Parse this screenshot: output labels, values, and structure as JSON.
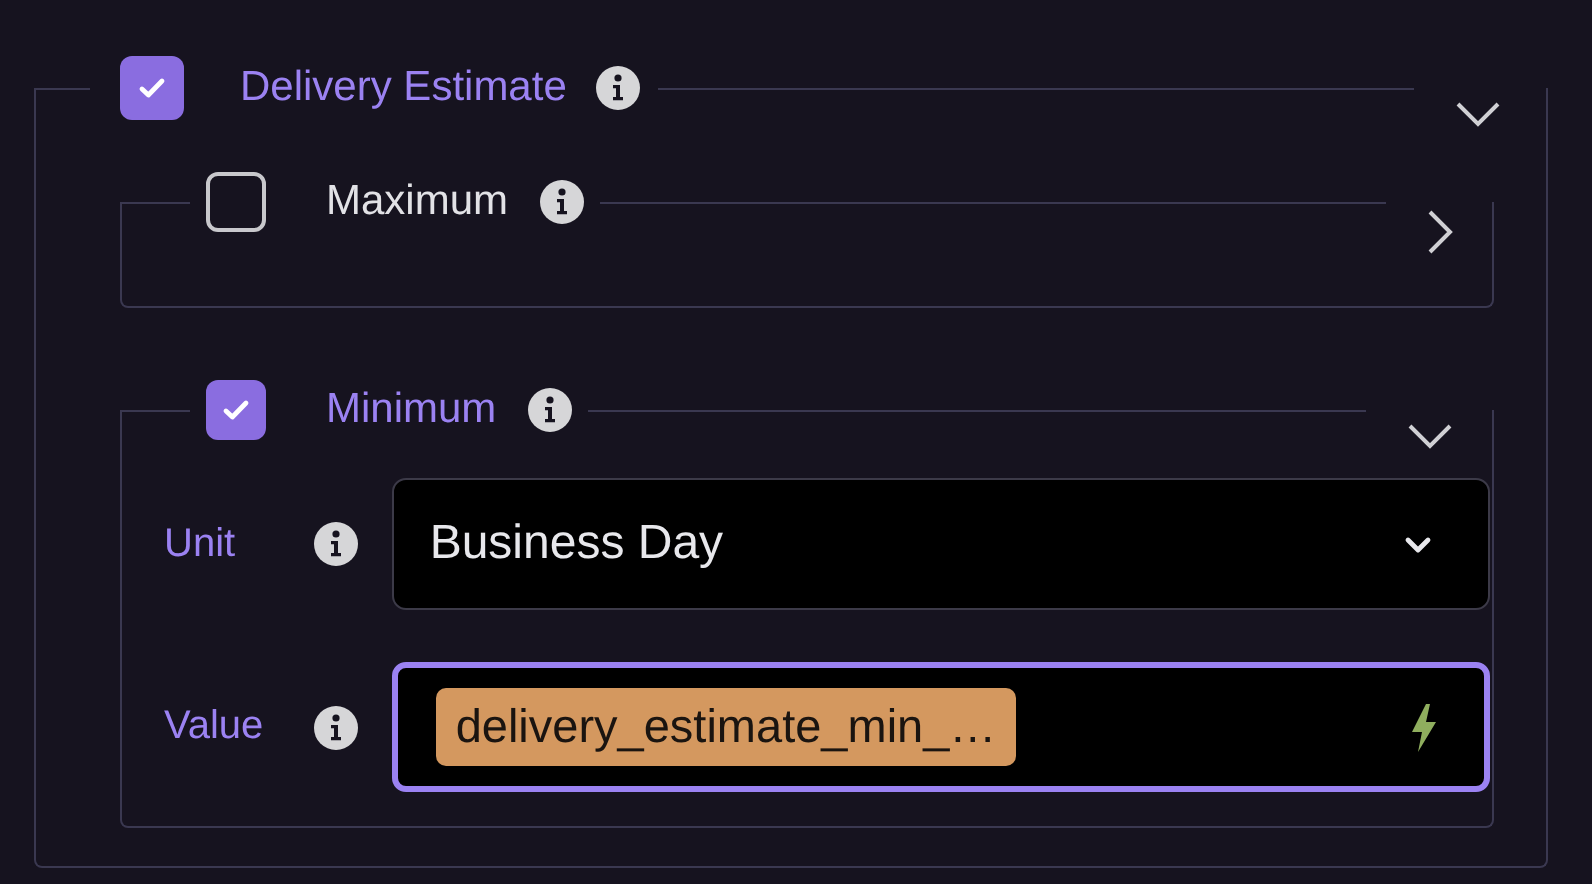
{
  "section": {
    "label": "Delivery Estimate",
    "checked": true,
    "expanded": true,
    "subsections": [
      {
        "label": "Maximum",
        "checked": false,
        "expanded": false
      },
      {
        "label": "Minimum",
        "checked": true,
        "expanded": true,
        "fields": [
          {
            "kind": "select",
            "label": "Unit",
            "value": "Business Day",
            "focused": false
          },
          {
            "kind": "token",
            "label": "Value",
            "token": "delivery_estimate_min_…",
            "focused": true
          }
        ]
      }
    ]
  }
}
